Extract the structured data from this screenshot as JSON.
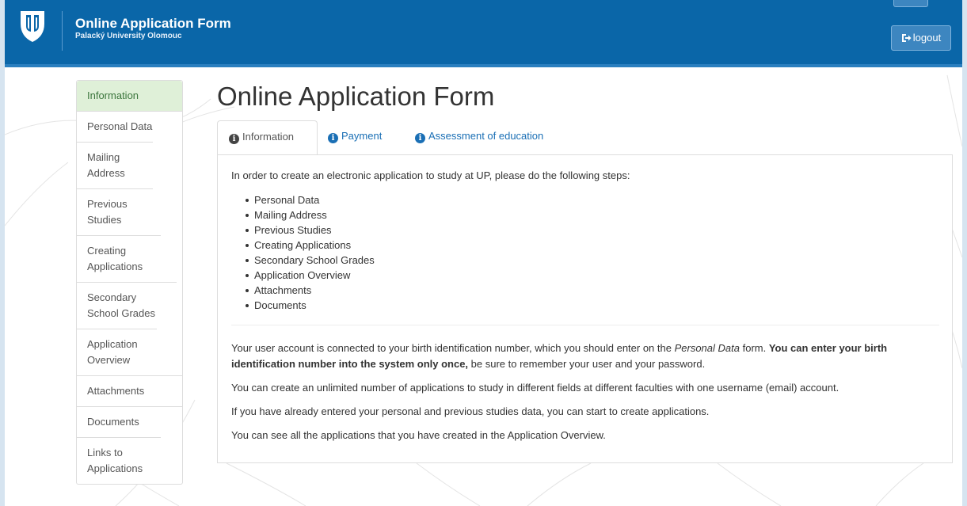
{
  "header": {
    "title": "Online Application Form",
    "subtitle": "Palacký University Olomouc",
    "logout_label": "logout",
    "logo_icon": "upol-logo-icon",
    "logout_icon": "sign-out-icon"
  },
  "sidebar": {
    "items": [
      {
        "label": "Information",
        "active": true
      },
      {
        "label": "Personal Data"
      },
      {
        "label": "Mailing Address"
      },
      {
        "label": "Previous Studies"
      },
      {
        "label": "Creating Applications"
      },
      {
        "label": "Secondary School Grades"
      },
      {
        "label": "Application Overview"
      },
      {
        "label": "Attachments"
      },
      {
        "label": "Documents"
      },
      {
        "label": "Links to Applications"
      }
    ]
  },
  "main": {
    "title": "Online Application Form",
    "tabs": [
      {
        "label": "Information",
        "active": true
      },
      {
        "label": "Payment"
      },
      {
        "label": "Assessment of education"
      }
    ],
    "intro": "In order to create an electronic application to study at UP, please do the following steps:",
    "steps": [
      "Personal Data",
      "Mailing Address",
      "Previous Studies",
      "Creating Applications",
      "Secondary School Grades",
      "Application Overview",
      "Attachments",
      "Documents"
    ],
    "para1": {
      "a": "Your user account is connected to your birth identification number, which you should enter on the ",
      "em": "Personal Data",
      "b": " form. ",
      "strong": "You can enter your birth identification number into the system only once,",
      "c": " be sure to remember your user and your password."
    },
    "para2": "You can create an unlimited number of applications to study in different fields at different faculties with one username (email) account.",
    "para3": "If you have already entered your personal and previous studies data, you can start to create applications.",
    "para4": "You can see all the applications that you have created in the Application Overview."
  },
  "colors": {
    "header": "#0a66a8",
    "active_side": "#dff0d8",
    "link": "#1a6fb5"
  }
}
